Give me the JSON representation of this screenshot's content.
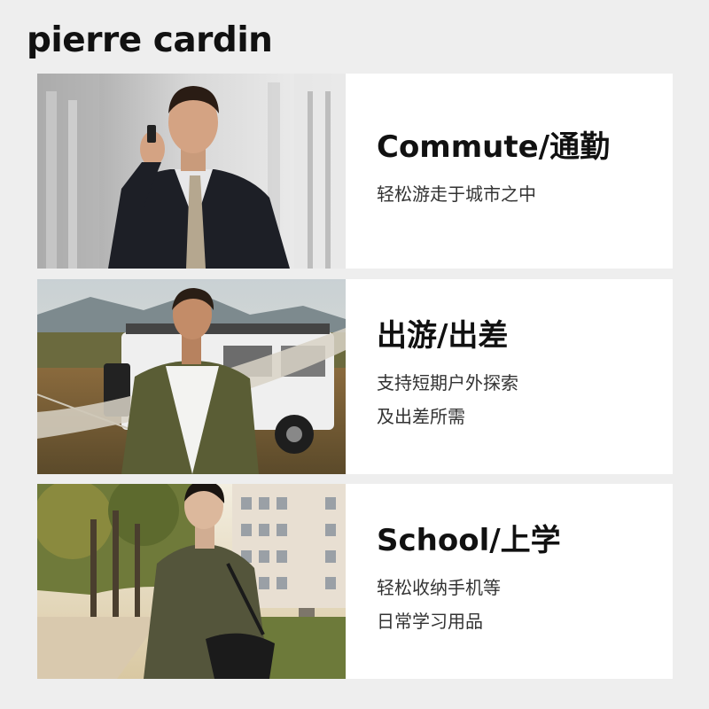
{
  "brand": {
    "logo_text": "pierre cardin"
  },
  "features": [
    {
      "title": "Commute/通勤",
      "desc": [
        "轻松游走于城市之中"
      ],
      "photo": "businessman-phone-photo"
    },
    {
      "title": "出游/出差",
      "desc": [
        "支持短期户外探索",
        "及出差所需"
      ],
      "photo": "outdoor-jeep-photo"
    },
    {
      "title": "School/上学",
      "desc": [
        "轻松收纳手机等",
        "日常学习用品"
      ],
      "photo": "campus-student-photo"
    }
  ],
  "colors": {
    "page_bg": "#eeeeee",
    "card_bg": "#ffffff",
    "text": "#111111"
  }
}
